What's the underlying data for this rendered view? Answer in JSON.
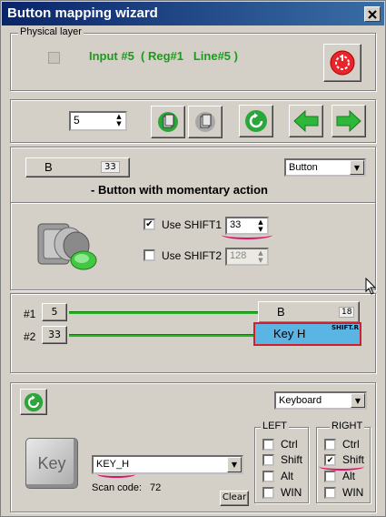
{
  "window": {
    "title": "Button mapping wizard"
  },
  "physical": {
    "group_label": "Physical layer",
    "input_text": "Input #5  ( Reg#1   Line#5 )"
  },
  "toolbar": {
    "index_value": "5"
  },
  "button_section": {
    "button_label": "B",
    "button_code": "33",
    "type_value": "Button",
    "description": "- Button with momentary action",
    "shift1_label": "Use SHIFT1",
    "shift1_checked": true,
    "shift1_value": "33",
    "shift2_label": "Use SHIFT2",
    "shift2_checked": false,
    "shift2_value": "128"
  },
  "mapping": {
    "rows": [
      {
        "num": "#1",
        "value": "5",
        "target_label": "B",
        "target_code": "18"
      },
      {
        "num": "#2",
        "value": "33",
        "target_label": "Key H",
        "target_tag": "SHIFT.R"
      }
    ]
  },
  "keyboard": {
    "mode_value": "Keyboard",
    "key_icon_label": "Key",
    "key_value": "KEY_H",
    "scan_code_label": "Scan code:",
    "scan_code_value": "72",
    "clear_label": "Clear",
    "left": {
      "label": "LEFT",
      "items": [
        {
          "label": "Ctrl",
          "checked": false
        },
        {
          "label": "Shift",
          "checked": false
        },
        {
          "label": "Alt",
          "checked": false
        },
        {
          "label": "WIN",
          "checked": false
        }
      ]
    },
    "right": {
      "label": "RIGHT",
      "items": [
        {
          "label": "Ctrl",
          "checked": false
        },
        {
          "label": "Shift",
          "checked": true
        },
        {
          "label": "Alt",
          "checked": false
        },
        {
          "label": "WIN",
          "checked": false
        }
      ]
    }
  },
  "colors": {
    "title_bar": "#0a246a",
    "accent_green": "#1a9c1a",
    "selected_key": "#5ab4e4",
    "highlight_red": "#d0202e",
    "annotation_pink": "#e0106e"
  },
  "icons": [
    "close-icon",
    "power-icon",
    "paste-icon",
    "copy-icon",
    "refresh-icon",
    "arrow-left-icon",
    "arrow-right-icon",
    "pushbutton-icon",
    "key-icon",
    "dropdown-icon"
  ]
}
